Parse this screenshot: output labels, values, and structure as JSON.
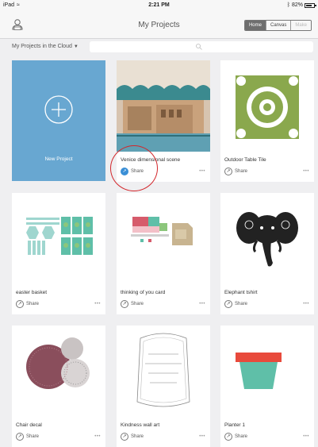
{
  "status": {
    "device": "iPad",
    "time": "2:21 PM",
    "battery": "82%",
    "battery_level": 0.82
  },
  "header": {
    "title": "My Projects",
    "segments": [
      "Home",
      "Canvas",
      "Make"
    ],
    "selected_segment": "Home"
  },
  "filter": {
    "label": "My Projects in the Cloud",
    "search_placeholder": ""
  },
  "new_project": {
    "label": "New Project"
  },
  "projects": [
    {
      "name": "Venice dimensional scene",
      "share": "Share",
      "more": "•••"
    },
    {
      "name": "Outdoor Table Tile",
      "share": "Share",
      "more": "•••"
    },
    {
      "name": "easter basket",
      "share": "Share",
      "more": "•••"
    },
    {
      "name": "thinking of you card",
      "share": "Share",
      "more": "•••"
    },
    {
      "name": "Elephant tshirt",
      "share": "Share",
      "more": "•••"
    },
    {
      "name": "Chair decal",
      "share": "Share",
      "more": "•••"
    },
    {
      "name": "Kindness wall art",
      "share": "Share",
      "more": "•••"
    },
    {
      "name": "Planter 1",
      "share": "Share",
      "more": "•••"
    }
  ],
  "colors": {
    "accent_blue": "#68a7d1",
    "share_active": "#3a8fd6",
    "highlight_red": "#d3262b"
  }
}
